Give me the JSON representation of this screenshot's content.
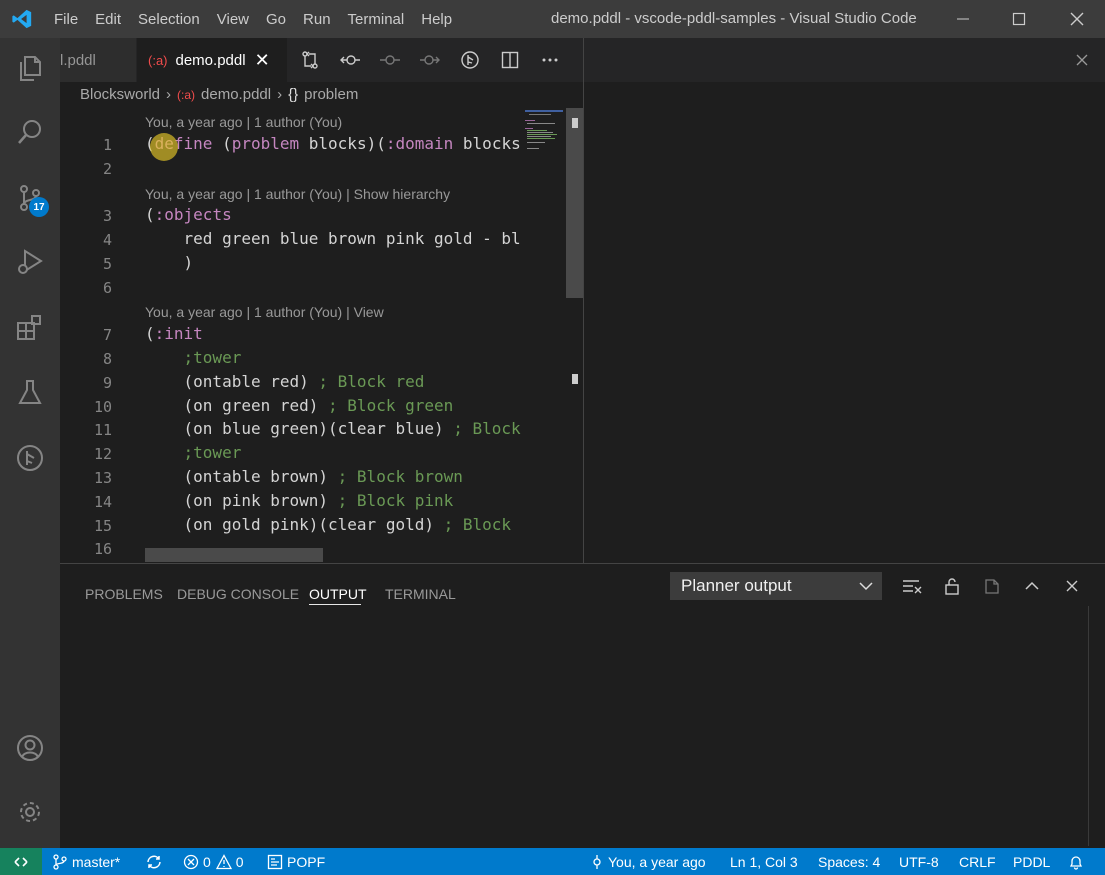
{
  "titlebar": {
    "menu": [
      "File",
      "Edit",
      "Selection",
      "View",
      "Go",
      "Run",
      "Terminal",
      "Help"
    ],
    "window_title": "demo.pddl - vscode-pddl-samples - Visual Studio Code"
  },
  "activity_bar": {
    "scm_badge": "17"
  },
  "tabs": [
    {
      "label": "l.pddl"
    },
    {
      "label": "demo.pddl",
      "icon_text": "(:a)"
    }
  ],
  "breadcrumb": {
    "folder": "Blocksworld",
    "file": "demo.pddl",
    "symbol_icon": "{}",
    "symbol": "problem"
  },
  "codelens": {
    "l1": "You, a year ago | 1 author (You)",
    "l3": "You, a year ago | 1 author (You) | Show hierarchy",
    "l7": "You, a year ago | 1 author (You) | View"
  },
  "line_numbers": [
    "1",
    "2",
    "3",
    "4",
    "5",
    "6",
    "7",
    "8",
    "9",
    "10",
    "11",
    "12",
    "13",
    "14",
    "15",
    "16"
  ],
  "code": {
    "l1": {
      "a": "(",
      "b": "define",
      "c": " (",
      "d": "problem",
      "e": " blocks)(",
      "f": ":domain",
      "g": " blocks"
    },
    "l3": {
      "a": "(",
      "b": ":objects"
    },
    "l4": "    red green blue brown pink gold - bl",
    "l5": "    )",
    "l7": {
      "a": "(",
      "b": ":init"
    },
    "l8": "    ;tower",
    "l9": {
      "code": "    (ontable red) ",
      "comment": "; Block red"
    },
    "l10": {
      "code": "    (on green red) ",
      "comment": "; Block green"
    },
    "l11": {
      "code": "    (on blue green)(clear blue) ",
      "comment": "; Block"
    },
    "l12": "    ;tower",
    "l13": {
      "code": "    (ontable brown) ",
      "comment": "; Block brown"
    },
    "l14": {
      "code": "    (on pink brown) ",
      "comment": "; Block pink"
    },
    "l15": {
      "code": "    (on gold pink)(clear gold) ",
      "comment": "; Block"
    }
  },
  "panel": {
    "tabs": [
      "PROBLEMS",
      "DEBUG CONSOLE",
      "OUTPUT",
      "TERMINAL"
    ],
    "active_tab": "OUTPUT",
    "dropdown_value": "Planner output"
  },
  "statusbar": {
    "branch": "master*",
    "errors": "0",
    "warnings": "0",
    "planner": "POPF",
    "blame": "You, a year ago",
    "cursor": "Ln 1, Col 3",
    "spaces": "Spaces: 4",
    "encoding": "UTF-8",
    "eol": "CRLF",
    "language": "PDDL"
  },
  "colors": {
    "accent": "#007acc",
    "remote": "#16825d",
    "keyword": "#c586c0",
    "comment": "#6a9955"
  }
}
